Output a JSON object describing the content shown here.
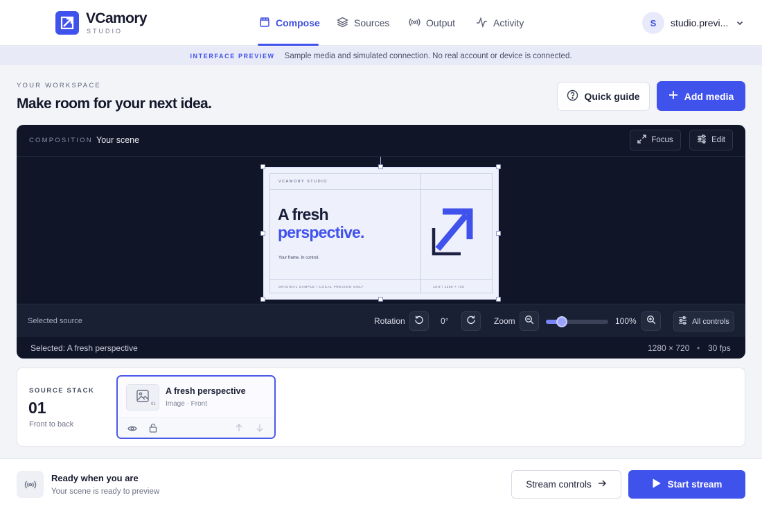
{
  "app": {
    "name": "VCamory",
    "subtitle": "STUDIO"
  },
  "nav": {
    "items": [
      {
        "label": "Compose",
        "icon": "clapperboard-icon",
        "active": true
      },
      {
        "label": "Sources",
        "icon": "layers-icon"
      },
      {
        "label": "Output",
        "icon": "broadcast-icon"
      },
      {
        "label": "Activity",
        "icon": "activity-icon"
      }
    ]
  },
  "user": {
    "initial": "S",
    "name": "studio.previ..."
  },
  "banner": {
    "tag": "INTERFACE PREVIEW",
    "text": "Sample media and simulated connection. No real account or device is connected."
  },
  "workspace": {
    "eyebrow": "YOUR WORKSPACE",
    "title": "Make room for your next idea."
  },
  "actions": {
    "guide_label": "Quick guide",
    "add_label": "Add media"
  },
  "composition": {
    "label": "COMPOSITION",
    "scene": "Your scene",
    "focus_label": "Focus",
    "edit_label": "Edit"
  },
  "preview": {
    "brand": "VCAMORY STUDIO",
    "headline_1": "A fresh",
    "headline_2": "perspective.",
    "tagline": "Your frame. In control.",
    "footer_left": "ORIGINAL SAMPLE / LOCAL PREVIEW ONLY",
    "footer_right": "16:9 / 1280 × 720"
  },
  "controls": {
    "selected_label": "Selected source",
    "rotation_label": "Rotation",
    "rotation_value": "0°",
    "zoom_label": "Zoom",
    "zoom_value": "100%",
    "zoom_level": 0.25,
    "all_controls_label": "All controls"
  },
  "status": {
    "selected": "Selected: A fresh perspective",
    "resolution": "1280 × 720",
    "separator": "•",
    "fps": "30 fps"
  },
  "stack": {
    "label": "SOURCE STACK",
    "count": "01",
    "order": "Front to back",
    "items": [
      {
        "title": "A fresh perspective",
        "meta": "Image · Front",
        "index": "01"
      }
    ]
  },
  "footer": {
    "title": "Ready when you are",
    "subtitle": "Your scene is ready to preview",
    "stream_controls_label": "Stream controls",
    "start_label": "Start stream"
  },
  "colors": {
    "accent": "#4052ec",
    "dark_panel": "#101627",
    "background": "#f3f4f8"
  }
}
